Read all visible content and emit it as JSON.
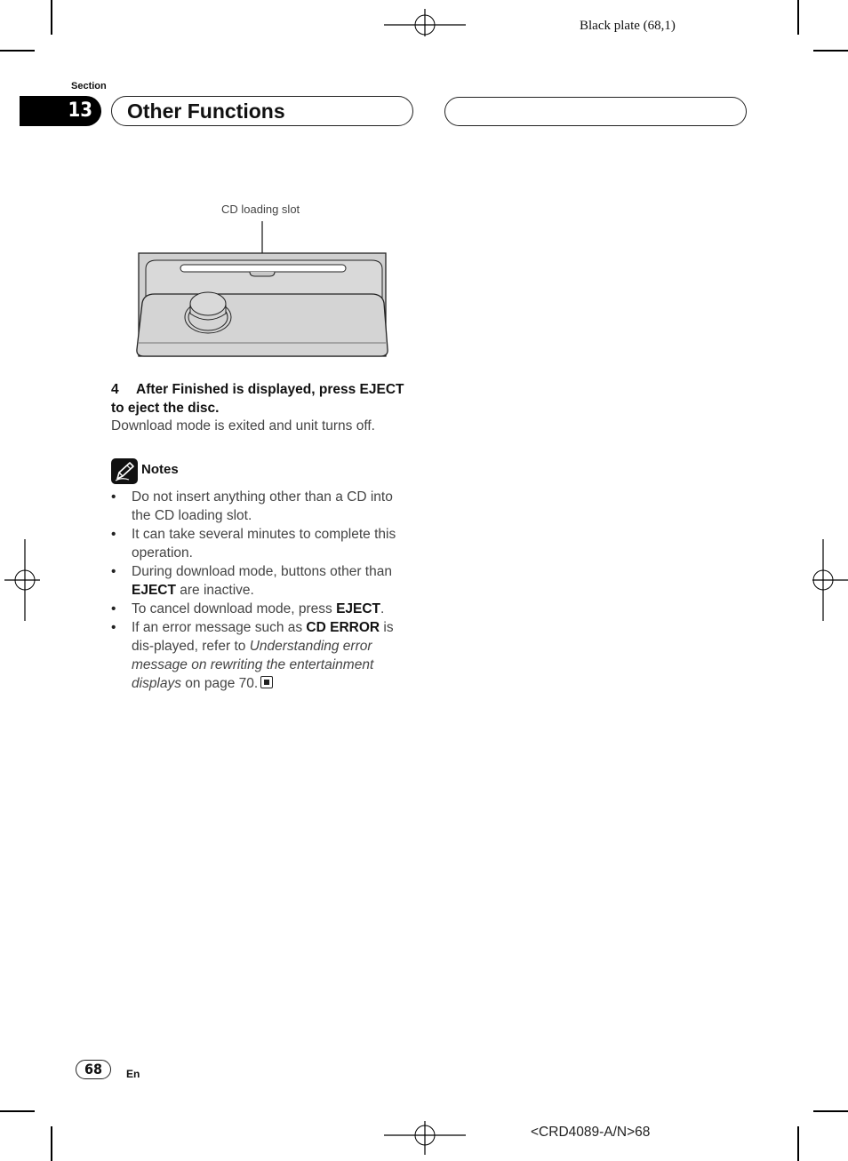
{
  "plate_label": "Black plate (68,1)",
  "header": {
    "section_label": "Section",
    "section_number": "13",
    "title": "Other Functions"
  },
  "figure": {
    "callout_label": "CD loading slot",
    "icon": "car-stereo-front-panel-illustration"
  },
  "step": {
    "number": "4",
    "instruction": "After Finished is displayed, press EJECT to eject the disc.",
    "result": "Download mode is exited and unit turns off."
  },
  "notes": {
    "icon": "pencil-icon",
    "title": "Notes",
    "items": [
      {
        "text": "Do not insert anything other than a CD into the CD loading slot."
      },
      {
        "text": "It can take several minutes to complete this operation."
      },
      {
        "bold_prefix": "",
        "pre": "During download mode, buttons other than ",
        "bold": "EJECT",
        "post": " are inactive."
      },
      {
        "pre": "To cancel download mode, press ",
        "bold": "EJECT",
        "post": "."
      },
      {
        "pre": "If an error message such as ",
        "bold": "CD ERROR",
        "mid": " is dis-played, refer to ",
        "italic": "Understanding error message on rewriting the entertainment displays",
        "post": " on page 70."
      }
    ],
    "end_mark_icon": "end-of-section-icon"
  },
  "footer": {
    "page_number": "68",
    "language": "En",
    "document_code": "<CRD4089-A/N>68"
  }
}
